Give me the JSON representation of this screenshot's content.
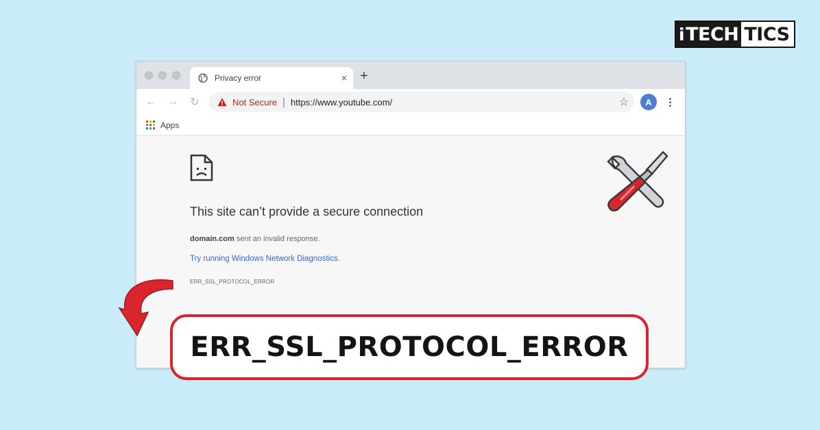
{
  "logo": {
    "i": "i",
    "tech": "TECH",
    "tics": "TICS"
  },
  "browser": {
    "tab_title": "Privacy error",
    "new_tab": "+",
    "close": "×",
    "not_secure": "Not Secure",
    "separator": "|",
    "url": "https://www.youtube.com/",
    "avatar": "A",
    "bookmark_apps": "Apps"
  },
  "error_page": {
    "headline": "This site can’t provide a secure connection",
    "domain": "domain.com",
    "message_rest": " sent an invalid response.",
    "diagnostics_link": "Try running Windows Network Diagnostics.",
    "error_code": "ERR_SSL_PROTOCOL_ERROR"
  },
  "callout": {
    "text": "ERR_SSL_PROTOCOL_ERROR"
  },
  "colors": {
    "background": "#c9ecf8",
    "accent_red": "#d8252e",
    "link_blue": "#3367d6"
  }
}
